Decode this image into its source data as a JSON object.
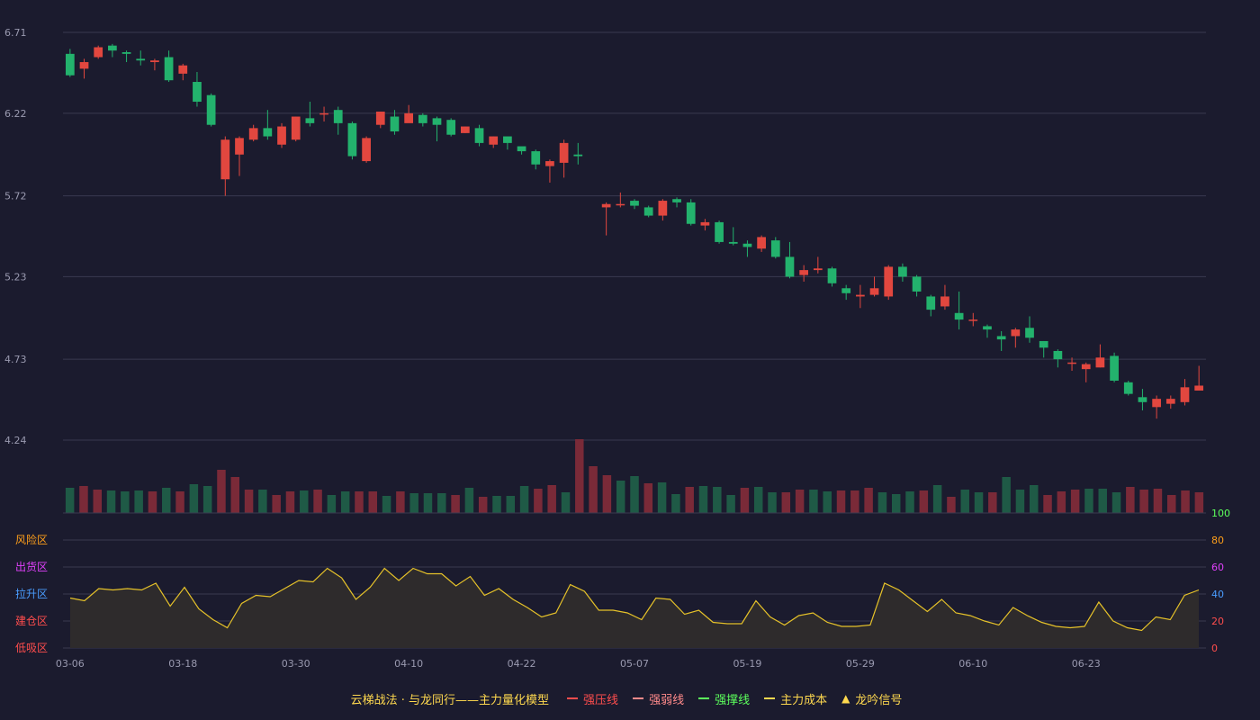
{
  "colors": {
    "background": "#1b1b2e",
    "grid": "#3a3a50",
    "axis_text": "#9a9ab0",
    "up": "#e2473f",
    "down": "#23b26d",
    "vol_up": "#7a2a38",
    "vol_down": "#1f5a46",
    "indicator": "#e6c229",
    "indicator_fill": "#2e2b2c"
  },
  "legend": {
    "title": "云梯战法 · 与龙同行——主力量化模型",
    "items": [
      {
        "label": "强压线",
        "color": "#ff4d4d",
        "style": "solid"
      },
      {
        "label": "强弱线",
        "color": "#ff8a8a",
        "style": "dashed"
      },
      {
        "label": "强撑线",
        "color": "#5cff5c",
        "style": "solid"
      },
      {
        "label": "主力成本",
        "color": "#ffd94f",
        "style": "dashed"
      },
      {
        "label": "龙吟信号",
        "color": "#ffd94f",
        "style": "triangle"
      }
    ]
  },
  "zones": [
    {
      "label": "风险区",
      "color": "#ff9f1a"
    },
    {
      "label": "出货区",
      "color": "#e040fb"
    },
    {
      "label": "拉升区",
      "color": "#4a9dff"
    },
    {
      "label": "建仓区",
      "color": "#ff4d4d"
    },
    {
      "label": "低吸区",
      "color": "#ff4d4d"
    }
  ],
  "chart_data": [
    {
      "type": "candlestick",
      "y_ticks": [
        "6.71",
        "6.22",
        "5.72",
        "5.23",
        "4.73",
        "4.24"
      ],
      "ylim": [
        4.24,
        6.71
      ],
      "x_ticks": [
        "03-06",
        "03-18",
        "03-30",
        "04-10",
        "04-22",
        "05-07",
        "05-19",
        "05-29",
        "06-10",
        "06-23"
      ],
      "x_tick_index": [
        0,
        8,
        16,
        24,
        32,
        40,
        48,
        56,
        64,
        72
      ],
      "candles": [
        [
          6.58,
          6.45,
          6.61,
          6.44
        ],
        [
          6.49,
          6.53,
          6.55,
          6.43
        ],
        [
          6.56,
          6.62,
          6.63,
          6.55
        ],
        [
          6.63,
          6.6,
          6.64,
          6.56
        ],
        [
          6.59,
          6.58,
          6.6,
          6.53
        ],
        [
          6.55,
          6.54,
          6.6,
          6.51
        ],
        [
          6.53,
          6.54,
          6.55,
          6.48
        ],
        [
          6.56,
          6.42,
          6.6,
          6.41
        ],
        [
          6.46,
          6.51,
          6.52,
          6.42
        ],
        [
          6.41,
          6.29,
          6.47,
          6.26
        ],
        [
          6.33,
          6.15,
          6.34,
          6.14
        ],
        [
          5.82,
          6.06,
          6.08,
          5.72
        ],
        [
          5.97,
          6.07,
          6.08,
          5.84
        ],
        [
          6.06,
          6.13,
          6.15,
          6.05
        ],
        [
          6.13,
          6.08,
          6.24,
          6.06
        ],
        [
          6.03,
          6.14,
          6.16,
          6.01
        ],
        [
          6.06,
          6.2,
          6.2,
          6.05
        ],
        [
          6.19,
          6.16,
          6.29,
          6.14
        ],
        [
          6.22,
          6.22,
          6.26,
          6.17
        ],
        [
          6.24,
          6.16,
          6.26,
          6.09
        ],
        [
          6.16,
          5.96,
          6.17,
          5.94
        ],
        [
          5.93,
          6.07,
          6.08,
          5.92
        ],
        [
          6.15,
          6.23,
          6.23,
          6.13
        ],
        [
          6.2,
          6.11,
          6.24,
          6.09
        ],
        [
          6.16,
          6.22,
          6.27,
          6.17
        ],
        [
          6.21,
          6.16,
          6.22,
          6.14
        ],
        [
          6.19,
          6.15,
          6.2,
          6.05
        ],
        [
          6.18,
          6.09,
          6.19,
          6.08
        ],
        [
          6.1,
          6.14,
          6.14,
          6.1
        ],
        [
          6.13,
          6.04,
          6.15,
          6.02
        ],
        [
          6.03,
          6.08,
          6.08,
          6.01
        ],
        [
          6.08,
          6.04,
          6.06,
          6.0
        ],
        [
          6.02,
          5.99,
          6.0,
          5.97
        ],
        [
          5.99,
          5.91,
          6.0,
          5.88
        ],
        [
          5.9,
          5.93,
          5.94,
          5.8
        ],
        [
          5.92,
          6.04,
          6.06,
          5.83
        ],
        [
          5.97,
          5.96,
          6.04,
          5.91
        ],
        null,
        [
          5.65,
          5.67,
          5.68,
          5.48
        ],
        [
          5.67,
          5.67,
          5.74,
          5.65
        ],
        [
          5.69,
          5.66,
          5.7,
          5.64
        ],
        [
          5.65,
          5.6,
          5.66,
          5.59
        ],
        [
          5.6,
          5.69,
          5.7,
          5.57
        ],
        [
          5.7,
          5.68,
          5.71,
          5.65
        ],
        [
          5.68,
          5.55,
          5.7,
          5.54
        ],
        [
          5.54,
          5.56,
          5.58,
          5.51
        ],
        [
          5.56,
          5.44,
          5.57,
          5.43
        ],
        [
          5.44,
          5.43,
          5.53,
          5.42
        ],
        [
          5.43,
          5.41,
          5.45,
          5.35
        ],
        [
          5.4,
          5.47,
          5.48,
          5.38
        ],
        [
          5.45,
          5.35,
          5.47,
          5.34
        ],
        [
          5.35,
          5.23,
          5.44,
          5.22
        ],
        [
          5.24,
          5.27,
          5.3,
          5.2
        ],
        [
          5.27,
          5.28,
          5.35,
          5.25
        ],
        [
          5.28,
          5.19,
          5.29,
          5.17
        ],
        [
          5.16,
          5.13,
          5.18,
          5.09
        ],
        [
          5.11,
          5.12,
          5.18,
          5.04
        ],
        [
          5.12,
          5.16,
          5.23,
          5.11
        ],
        [
          5.11,
          5.29,
          5.3,
          5.09
        ],
        [
          5.29,
          5.23,
          5.31,
          5.2
        ],
        [
          5.23,
          5.14,
          5.24,
          5.11
        ],
        [
          5.11,
          5.03,
          5.12,
          4.99
        ],
        [
          5.05,
          5.11,
          5.18,
          5.03
        ],
        [
          5.01,
          4.97,
          5.14,
          4.91
        ],
        [
          4.97,
          4.97,
          5.01,
          4.93
        ],
        [
          4.93,
          4.91,
          4.94,
          4.86
        ],
        [
          4.87,
          4.85,
          4.9,
          4.78
        ],
        [
          4.87,
          4.91,
          4.92,
          4.8
        ],
        [
          4.92,
          4.86,
          4.99,
          4.83
        ],
        [
          4.84,
          4.8,
          4.84,
          4.74
        ],
        [
          4.78,
          4.73,
          4.79,
          4.68
        ],
        [
          4.71,
          4.71,
          4.74,
          4.66
        ],
        [
          4.67,
          4.7,
          4.71,
          4.59
        ],
        [
          4.68,
          4.74,
          4.82,
          4.68
        ],
        [
          4.75,
          4.6,
          4.77,
          4.59
        ],
        [
          4.59,
          4.52,
          4.6,
          4.51
        ],
        [
          4.5,
          4.47,
          4.55,
          4.42
        ],
        [
          4.44,
          4.49,
          4.51,
          4.37
        ],
        [
          4.46,
          4.49,
          4.51,
          4.43
        ],
        [
          4.47,
          4.56,
          4.61,
          4.45
        ],
        [
          4.54,
          4.57,
          4.69,
          4.55
        ]
      ]
    },
    {
      "type": "bar",
      "title": "volume",
      "values": [
        28,
        30,
        26,
        25,
        24,
        25,
        24,
        28,
        24,
        32,
        30,
        48,
        40,
        26,
        26,
        20,
        24,
        25,
        26,
        20,
        24,
        24,
        24,
        19,
        24,
        22,
        22,
        22,
        20,
        28,
        18,
        19,
        19,
        30,
        27,
        31,
        23,
        82,
        52,
        42,
        36,
        41,
        33,
        34,
        21,
        29,
        30,
        29,
        20,
        28,
        29,
        23,
        23,
        26,
        26,
        24,
        25,
        25,
        28,
        23,
        21,
        24,
        25,
        31,
        18,
        26,
        23,
        23,
        40,
        26,
        31,
        20,
        24,
        26,
        27,
        27,
        23,
        29,
        26,
        27,
        20,
        25,
        23
      ]
    },
    {
      "type": "area",
      "ylim": [
        0,
        100
      ],
      "y_ticks": [
        "100",
        "80",
        "60",
        "40",
        "20",
        "0"
      ],
      "values": [
        37,
        35,
        44,
        43,
        44,
        43,
        48,
        31,
        45,
        29,
        21,
        15,
        33,
        39,
        38,
        44,
        50,
        49,
        59,
        52,
        36,
        45,
        59,
        50,
        59,
        55,
        55,
        46,
        53,
        39,
        44,
        36,
        30,
        23,
        26,
        47,
        42,
        28,
        28,
        26,
        21,
        37,
        36,
        25,
        28,
        19,
        18,
        18,
        35,
        23,
        17,
        24,
        26,
        19,
        16,
        16,
        17,
        48,
        43,
        35,
        27,
        36,
        26,
        24,
        20,
        17,
        30,
        24,
        19,
        16,
        15,
        16,
        34,
        20,
        15,
        13,
        23,
        21,
        39,
        43
      ]
    }
  ]
}
